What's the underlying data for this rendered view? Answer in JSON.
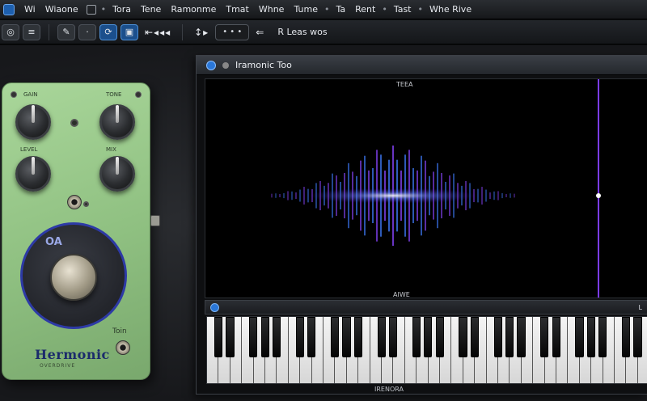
{
  "menubar": {
    "app_label": "Wi",
    "items": [
      "Wiaone",
      "Tora",
      "Tene",
      "Ramonme",
      "Tmat",
      "Whne",
      "Tume",
      "Ta",
      "Rent",
      "Tast",
      "Whe Rive"
    ],
    "separators": [
      "•",
      "•",
      "•",
      "•"
    ]
  },
  "toolbar": {
    "buttons": [
      {
        "name": "record-button",
        "icon": "circle-icon",
        "glyph": "◎"
      },
      {
        "name": "list-button",
        "icon": "list-icon",
        "glyph": "≡"
      },
      {
        "name": "pen-tool-button",
        "icon": "pen-icon",
        "glyph": "✎"
      },
      {
        "name": "dot-button",
        "icon": "dot-icon",
        "glyph": "·"
      },
      {
        "name": "loop-button",
        "icon": "loop-icon",
        "glyph": "⟳"
      },
      {
        "name": "monitor-button",
        "icon": "monitor-icon",
        "glyph": "▣"
      }
    ],
    "nav_arrows": "⇤◂◂◂",
    "cursor_glyph": "↕▸",
    "field_value": "• • •",
    "back_glyph": "⇐",
    "tempo_label": "R Leas wos"
  },
  "pedal": {
    "brand": "Hermonic",
    "subtitle": "OVERDRIVE",
    "footswitch_label": "OA",
    "output_label": "Toin",
    "knob_labels": [
      "GAIN",
      "TONE",
      "LEVEL",
      "MIX"
    ]
  },
  "plugin": {
    "title": "Iramonic Too",
    "display_top_label": "TEEA",
    "display_bottom_label": "AIWE",
    "keys_header_right": "L",
    "keyboard_footer": "IRENORA"
  },
  "colors": {
    "pedal_green": "#9acc8c",
    "accent_blue": "#2a77d8",
    "waveform_violet": "#7b3cff",
    "waveform_core": "#ffffff"
  }
}
